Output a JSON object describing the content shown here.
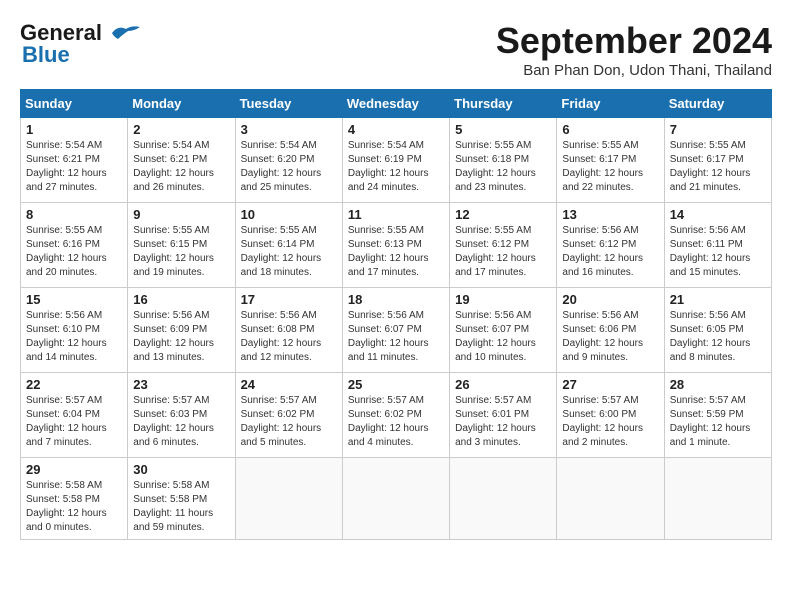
{
  "header": {
    "logo_line1": "General",
    "logo_line2": "Blue",
    "month_title": "September 2024",
    "location": "Ban Phan Don, Udon Thani, Thailand"
  },
  "weekdays": [
    "Sunday",
    "Monday",
    "Tuesday",
    "Wednesday",
    "Thursday",
    "Friday",
    "Saturday"
  ],
  "weeks": [
    [
      {
        "day": "1",
        "info": "Sunrise: 5:54 AM\nSunset: 6:21 PM\nDaylight: 12 hours\nand 27 minutes."
      },
      {
        "day": "2",
        "info": "Sunrise: 5:54 AM\nSunset: 6:21 PM\nDaylight: 12 hours\nand 26 minutes."
      },
      {
        "day": "3",
        "info": "Sunrise: 5:54 AM\nSunset: 6:20 PM\nDaylight: 12 hours\nand 25 minutes."
      },
      {
        "day": "4",
        "info": "Sunrise: 5:54 AM\nSunset: 6:19 PM\nDaylight: 12 hours\nand 24 minutes."
      },
      {
        "day": "5",
        "info": "Sunrise: 5:55 AM\nSunset: 6:18 PM\nDaylight: 12 hours\nand 23 minutes."
      },
      {
        "day": "6",
        "info": "Sunrise: 5:55 AM\nSunset: 6:17 PM\nDaylight: 12 hours\nand 22 minutes."
      },
      {
        "day": "7",
        "info": "Sunrise: 5:55 AM\nSunset: 6:17 PM\nDaylight: 12 hours\nand 21 minutes."
      }
    ],
    [
      {
        "day": "8",
        "info": "Sunrise: 5:55 AM\nSunset: 6:16 PM\nDaylight: 12 hours\nand 20 minutes."
      },
      {
        "day": "9",
        "info": "Sunrise: 5:55 AM\nSunset: 6:15 PM\nDaylight: 12 hours\nand 19 minutes."
      },
      {
        "day": "10",
        "info": "Sunrise: 5:55 AM\nSunset: 6:14 PM\nDaylight: 12 hours\nand 18 minutes."
      },
      {
        "day": "11",
        "info": "Sunrise: 5:55 AM\nSunset: 6:13 PM\nDaylight: 12 hours\nand 17 minutes."
      },
      {
        "day": "12",
        "info": "Sunrise: 5:55 AM\nSunset: 6:12 PM\nDaylight: 12 hours\nand 17 minutes."
      },
      {
        "day": "13",
        "info": "Sunrise: 5:56 AM\nSunset: 6:12 PM\nDaylight: 12 hours\nand 16 minutes."
      },
      {
        "day": "14",
        "info": "Sunrise: 5:56 AM\nSunset: 6:11 PM\nDaylight: 12 hours\nand 15 minutes."
      }
    ],
    [
      {
        "day": "15",
        "info": "Sunrise: 5:56 AM\nSunset: 6:10 PM\nDaylight: 12 hours\nand 14 minutes."
      },
      {
        "day": "16",
        "info": "Sunrise: 5:56 AM\nSunset: 6:09 PM\nDaylight: 12 hours\nand 13 minutes."
      },
      {
        "day": "17",
        "info": "Sunrise: 5:56 AM\nSunset: 6:08 PM\nDaylight: 12 hours\nand 12 minutes."
      },
      {
        "day": "18",
        "info": "Sunrise: 5:56 AM\nSunset: 6:07 PM\nDaylight: 12 hours\nand 11 minutes."
      },
      {
        "day": "19",
        "info": "Sunrise: 5:56 AM\nSunset: 6:07 PM\nDaylight: 12 hours\nand 10 minutes."
      },
      {
        "day": "20",
        "info": "Sunrise: 5:56 AM\nSunset: 6:06 PM\nDaylight: 12 hours\nand 9 minutes."
      },
      {
        "day": "21",
        "info": "Sunrise: 5:56 AM\nSunset: 6:05 PM\nDaylight: 12 hours\nand 8 minutes."
      }
    ],
    [
      {
        "day": "22",
        "info": "Sunrise: 5:57 AM\nSunset: 6:04 PM\nDaylight: 12 hours\nand 7 minutes."
      },
      {
        "day": "23",
        "info": "Sunrise: 5:57 AM\nSunset: 6:03 PM\nDaylight: 12 hours\nand 6 minutes."
      },
      {
        "day": "24",
        "info": "Sunrise: 5:57 AM\nSunset: 6:02 PM\nDaylight: 12 hours\nand 5 minutes."
      },
      {
        "day": "25",
        "info": "Sunrise: 5:57 AM\nSunset: 6:02 PM\nDaylight: 12 hours\nand 4 minutes."
      },
      {
        "day": "26",
        "info": "Sunrise: 5:57 AM\nSunset: 6:01 PM\nDaylight: 12 hours\nand 3 minutes."
      },
      {
        "day": "27",
        "info": "Sunrise: 5:57 AM\nSunset: 6:00 PM\nDaylight: 12 hours\nand 2 minutes."
      },
      {
        "day": "28",
        "info": "Sunrise: 5:57 AM\nSunset: 5:59 PM\nDaylight: 12 hours\nand 1 minute."
      }
    ],
    [
      {
        "day": "29",
        "info": "Sunrise: 5:58 AM\nSunset: 5:58 PM\nDaylight: 12 hours\nand 0 minutes."
      },
      {
        "day": "30",
        "info": "Sunrise: 5:58 AM\nSunset: 5:58 PM\nDaylight: 11 hours\nand 59 minutes."
      },
      {
        "day": "",
        "info": ""
      },
      {
        "day": "",
        "info": ""
      },
      {
        "day": "",
        "info": ""
      },
      {
        "day": "",
        "info": ""
      },
      {
        "day": "",
        "info": ""
      }
    ]
  ]
}
